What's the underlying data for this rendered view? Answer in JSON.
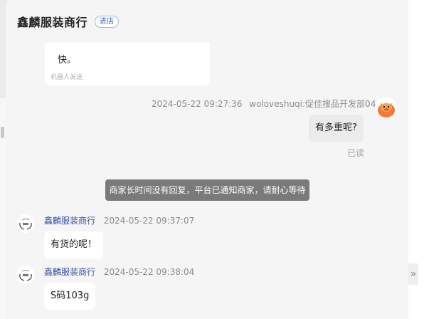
{
  "header": {
    "shop_name": "鑫麟服装商行",
    "badge": "进店"
  },
  "messages": {
    "top_partial": {
      "text": "快。",
      "robot_label": "机器人发送"
    },
    "outgoing": {
      "timestamp": "2024-05-22 09:27:36",
      "sender": "woloveshuqi:促佳搜品开发部044",
      "text": "有多重呢?",
      "status": "已读"
    },
    "system_notice": "商家长时间没有回复，平台已通知商家，请耐心等待",
    "incoming": [
      {
        "sender": "鑫麟服装商行",
        "timestamp": "2024-05-22 09:37:07",
        "text": "有货的呢！"
      },
      {
        "sender": "鑫麟服装商行",
        "timestamp": "2024-05-22 09:38:04",
        "text": "S码103g"
      }
    ]
  },
  "right_panel": {
    "collapse_glyph": "»"
  },
  "colors": {
    "sender_name": "#3b50a8",
    "notice_bg": "#7a7a7a",
    "badge_text": "#2f5cc7"
  }
}
